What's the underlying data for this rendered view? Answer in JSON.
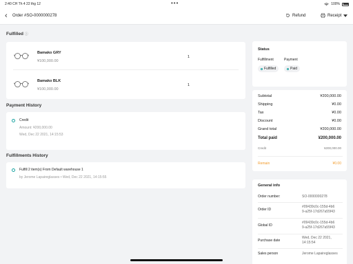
{
  "status_bar": {
    "time": "2:40 CH  Th 4 22 thg 12",
    "battery": "100%"
  },
  "header": {
    "back_icon": "chevron-left-icon",
    "title": "Order #SO-0000000278",
    "refund_label": "Refund",
    "receipt_label": "Receipt"
  },
  "fulfilled": {
    "title": "Fulfilled",
    "items": [
      {
        "name": "Bamako GRY",
        "price": "¥100,000.00",
        "qty": "1"
      },
      {
        "name": "Bamako BLK",
        "price": "¥100,000.00",
        "qty": "1"
      }
    ]
  },
  "payment_history": {
    "title": "Payment History",
    "method": "Credit",
    "amount": "Amount: ¥200,000.00",
    "date": "Wed, Dec 22 2021, 14:15:53"
  },
  "fulfillments_history": {
    "title": "Fulfillments History",
    "line1": "Fulfill 2 item(s) From Default warehouse 1",
    "line2": "by Jerome Lapaireglasses • Wed, Dec 22 2021, 14:15:55"
  },
  "status": {
    "title": "Status",
    "fulfillment_label": "Fulfillment",
    "payment_label": "Payment",
    "fulfillment_value": "Fulfilled",
    "payment_value": "Paid"
  },
  "summary": {
    "rows": [
      {
        "label": "Subtotal",
        "value": "¥200,000.00"
      },
      {
        "label": "Shipping",
        "value": "¥0.00"
      },
      {
        "label": "Tax",
        "value": "¥0.00"
      },
      {
        "label": "Discount",
        "value": "¥0.00"
      },
      {
        "label": "Grand total",
        "value": "¥200,000.00"
      }
    ],
    "total_paid_label": "Total paid",
    "total_paid_value": "¥200,000.00",
    "credit_label": "Credit",
    "credit_value": "¥200,000.00",
    "remain_label": "Remain",
    "remain_value": "¥0.00"
  },
  "general_info": {
    "title": "General info",
    "order_number_label": "Order number:",
    "order_number": "SO-0000000278",
    "order_id_label": "Order ID",
    "order_id_1": "#09439c0c-155d-4b6",
    "order_id_2": "9-a25f-17d267a55f43",
    "global_id_label": "Global ID",
    "global_id_1": "#09439c0c-155d-4b6",
    "global_id_2": "9-a25f-17d267a55f43",
    "purchase_date_label": "Purchase date",
    "purchase_date_1": "Wed, Dec 22 2021,",
    "purchase_date_2": "14:15:54",
    "sales_person_label": "Sales person",
    "sales_person": "Jerome Lapaireglasses"
  },
  "colors": {
    "accent": "#17a2a0",
    "remain": "#f29b2c",
    "background": "#f2f3f5"
  }
}
